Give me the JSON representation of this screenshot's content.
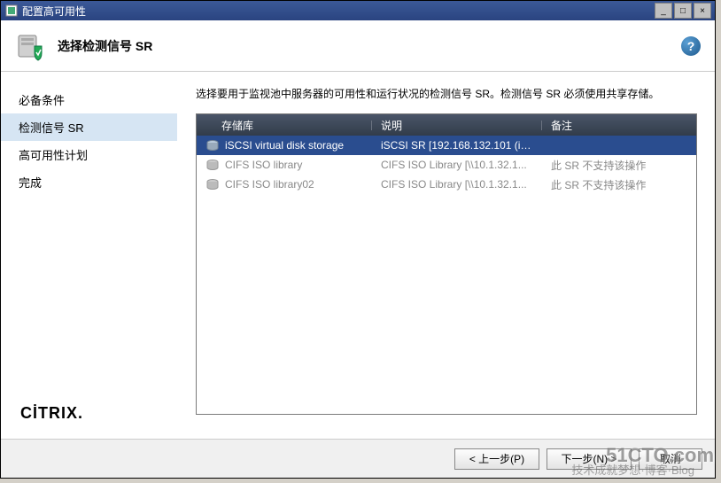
{
  "window": {
    "title": "配置高可用性"
  },
  "header": {
    "title": "选择检测信号 SR"
  },
  "sidebar": {
    "items": [
      {
        "label": "必备条件",
        "active": false
      },
      {
        "label": "检测信号 SR",
        "active": true
      },
      {
        "label": "高可用性计划",
        "active": false
      },
      {
        "label": "完成",
        "active": false
      }
    ]
  },
  "main": {
    "instruction": "选择要用于监视池中服务器的可用性和运行状况的检测信号 SR。检测信号 SR 必须使用共享存储。",
    "columns": {
      "storage": "存储库",
      "description": "说明",
      "remark": "备注"
    },
    "rows": [
      {
        "storage": "iSCSI virtual disk storage",
        "description": "iSCSI SR [192.168.132.101 (iq...",
        "remark": "",
        "selected": true,
        "disabled": false
      },
      {
        "storage": "CIFS ISO library",
        "description": "CIFS ISO Library [\\\\10.1.32.1...",
        "remark": "此 SR 不支持该操作",
        "selected": false,
        "disabled": true
      },
      {
        "storage": "CIFS ISO library02",
        "description": "CIFS ISO Library [\\\\10.1.32.1...",
        "remark": "此 SR 不支持该操作",
        "selected": false,
        "disabled": true
      }
    ]
  },
  "brand": "CİTRIX",
  "footer": {
    "prev": "< 上一步(P)",
    "next": "下一步(N) >",
    "cancel": "取消"
  },
  "watermark": {
    "main": "51CTO.com",
    "sub": "技术成就梦想·博客·Blog"
  }
}
